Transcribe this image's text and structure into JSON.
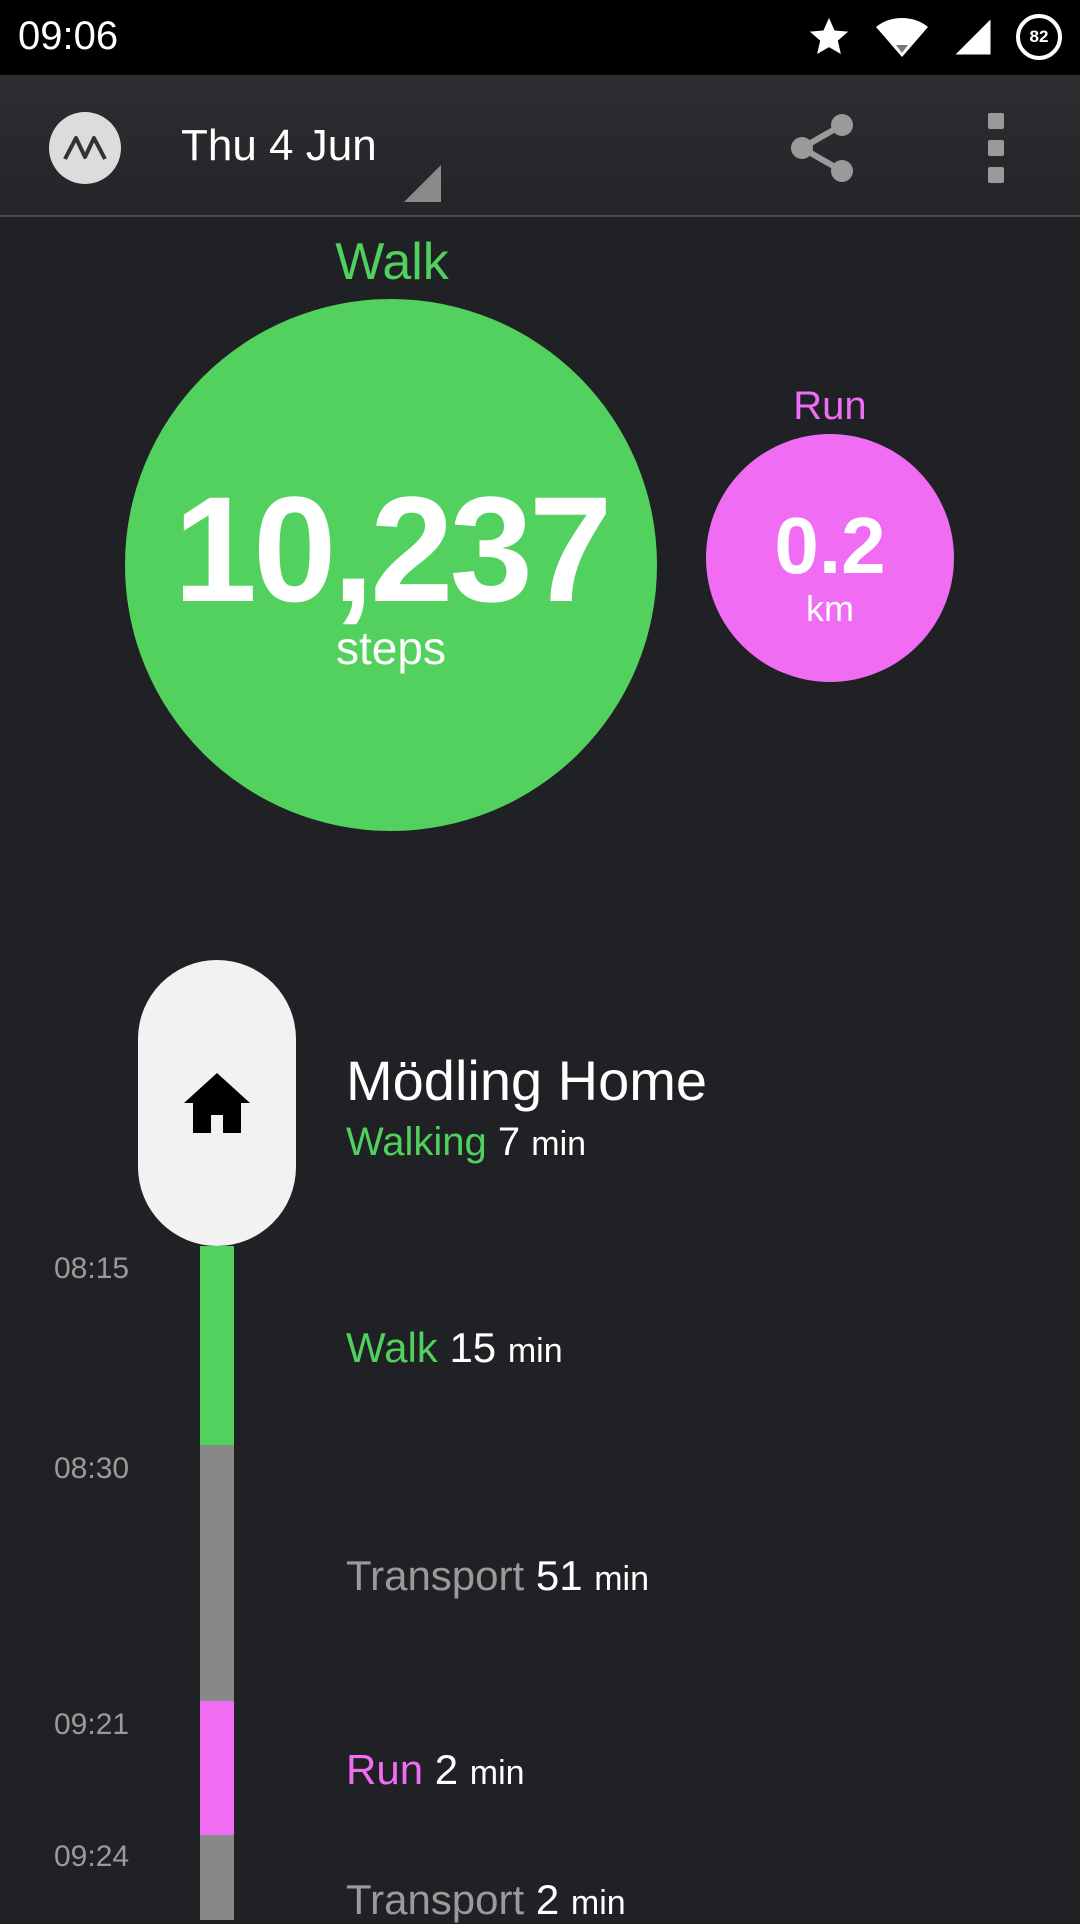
{
  "status_bar": {
    "time": "09:06",
    "battery": "82"
  },
  "app_bar": {
    "date": "Thu 4 Jun"
  },
  "summary": {
    "walk": {
      "title": "Walk",
      "value": "10,237",
      "unit": "steps"
    },
    "run": {
      "title": "Run",
      "value": "0.2",
      "unit": "km"
    }
  },
  "timeline": {
    "place": {
      "name": "Mödling Home",
      "mode": "Walking",
      "duration": "7",
      "unit": "min"
    },
    "times": [
      "08:15",
      "08:30",
      "09:21",
      "09:24"
    ],
    "activities": [
      {
        "label": "Walk",
        "duration": "15",
        "unit": "min"
      },
      {
        "label": "Transport",
        "duration": "51",
        "unit": "min"
      },
      {
        "label": "Run",
        "duration": "2",
        "unit": "min"
      },
      {
        "label": "Transport",
        "duration": "2",
        "unit": "min"
      }
    ]
  },
  "colors": {
    "walk": "#52d15e",
    "run": "#f06cf3",
    "transport": "#888888",
    "background": "#202124"
  }
}
